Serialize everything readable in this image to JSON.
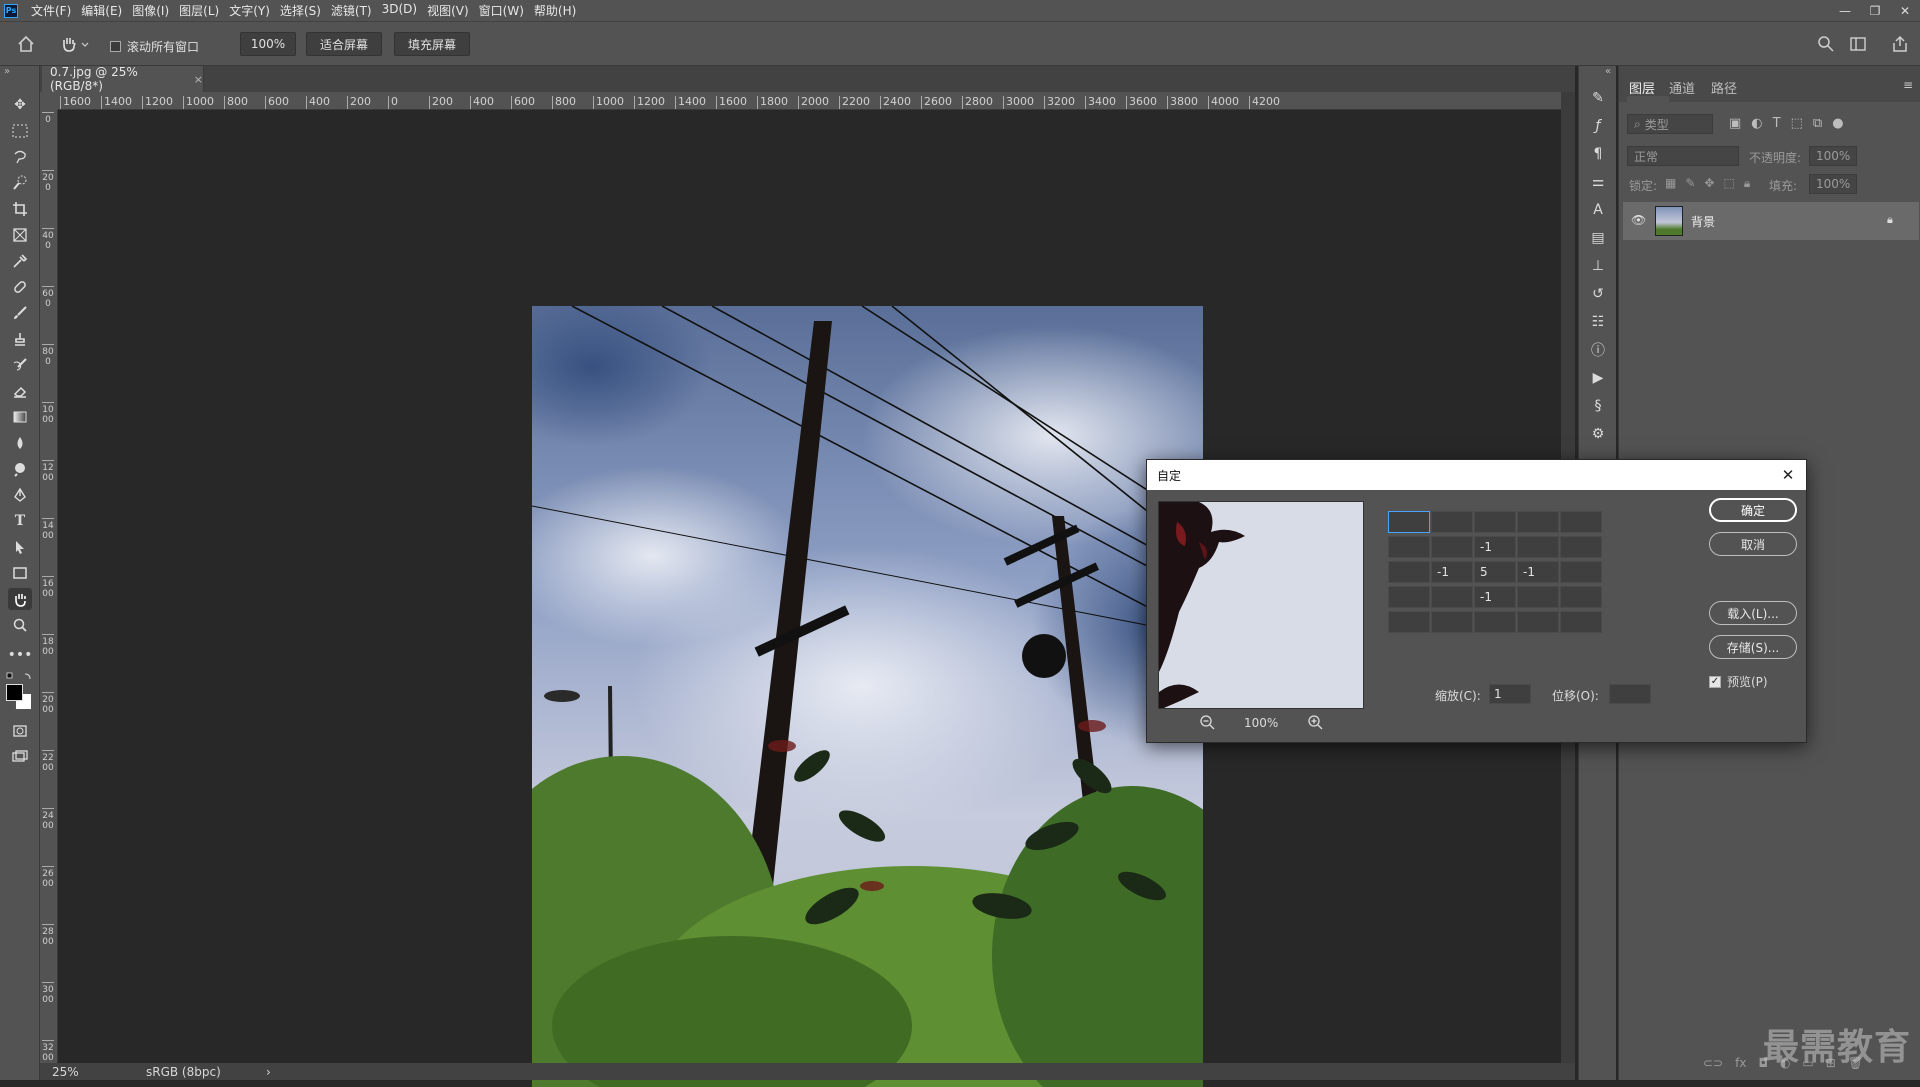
{
  "menubar": {
    "logo": "Ps",
    "items": [
      "文件(F)",
      "编辑(E)",
      "图像(I)",
      "图层(L)",
      "文字(Y)",
      "选择(S)",
      "滤镜(T)",
      "3D(D)",
      "视图(V)",
      "窗口(W)",
      "帮助(H)"
    ],
    "window_controls": [
      "—",
      "❐",
      "✕"
    ]
  },
  "options": {
    "scroll_all_label": "滚动所有窗口",
    "zoom_value": "100%",
    "fit_screen": "适合屏幕",
    "fill_screen": "填充屏幕"
  },
  "document": {
    "tab_title": "0.7.jpg @ 25%(RGB/8*)",
    "close_glyph": "×"
  },
  "ruler": {
    "h_labels": [
      "1600",
      "1400",
      "1200",
      "1000",
      "800",
      "600",
      "400",
      "200",
      "0",
      "200",
      "400",
      "600",
      "800",
      "1000",
      "1200",
      "1400",
      "1600",
      "1800",
      "2000",
      "2200",
      "2400",
      "2600",
      "2800",
      "3000",
      "3200",
      "3400",
      "3600",
      "3800",
      "4000",
      "4200"
    ],
    "v_labels": [
      "0",
      "200",
      "400",
      "600",
      "800",
      "1000",
      "1200",
      "1400",
      "1600",
      "1800",
      "2000",
      "2200",
      "2400",
      "2600",
      "2800",
      "3000",
      "3200"
    ]
  },
  "status": {
    "zoom": "25%",
    "profile": "sRGB (8bpc)",
    "arrow": "›"
  },
  "layers_panel": {
    "tabs": [
      "图层",
      "通道",
      "路径"
    ],
    "filter_placeholder": "类型",
    "blend_mode": "正常",
    "opacity_label": "不透明度:",
    "opacity_value": "100%",
    "lock_label": "锁定:",
    "fill_label": "填充:",
    "fill_value": "100%",
    "layer_name": "背景"
  },
  "dialog": {
    "title": "自定",
    "close": "✕",
    "preview_zoom": "100%",
    "matrix": [
      [
        "",
        "",
        "",
        "",
        ""
      ],
      [
        "",
        "",
        "-1",
        "",
        ""
      ],
      [
        "",
        "-1",
        "5",
        "-1",
        ""
      ],
      [
        "",
        "",
        "-1",
        "",
        ""
      ],
      [
        "",
        "",
        "",
        "",
        ""
      ]
    ],
    "scale_label": "缩放(C):",
    "scale_value": "1",
    "offset_label": "位移(O):",
    "offset_value": "",
    "ok": "确定",
    "cancel": "取消",
    "load": "载入(L)...",
    "save": "存储(S)...",
    "preview_label": "预览(P)",
    "preview_checked": true
  },
  "watermark": "最需教育"
}
